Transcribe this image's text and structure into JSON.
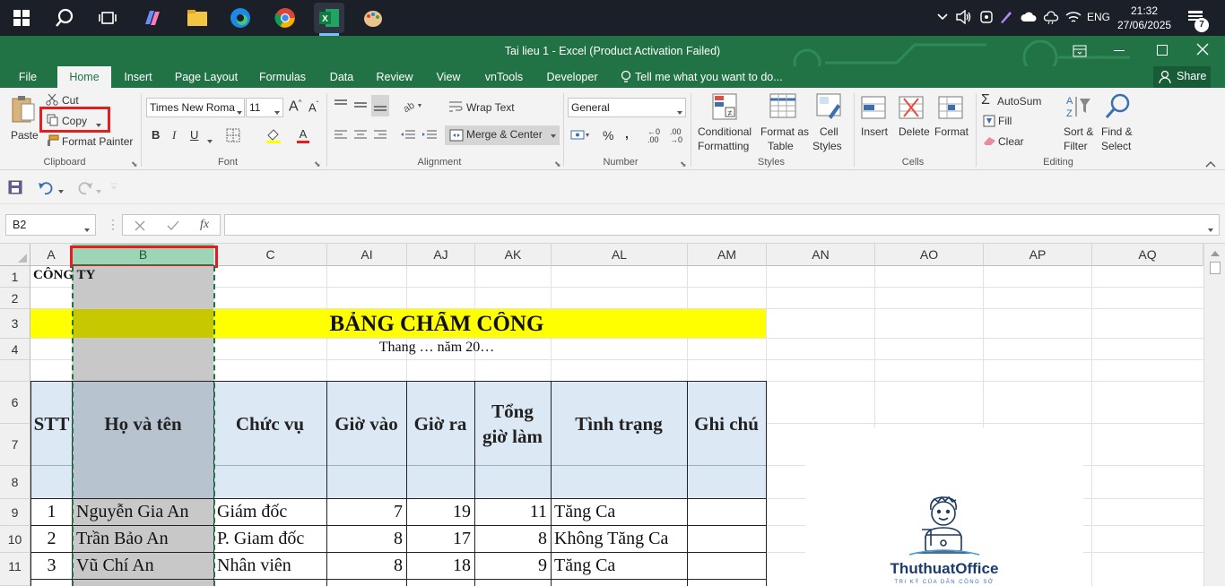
{
  "taskbar": {
    "time": "21:32",
    "date": "27/06/2025",
    "lang": "ENG",
    "notif_count": "7"
  },
  "titlebar": {
    "title": "Tai lieu 1 - Excel (Product Activation Failed)"
  },
  "tabs": [
    "File",
    "Home",
    "Insert",
    "Page Layout",
    "Formulas",
    "Data",
    "Review",
    "View",
    "vnTools",
    "Developer"
  ],
  "tell_me": "Tell me what you want to do...",
  "share": "Share",
  "clipboard": {
    "paste": "Paste",
    "cut": "Cut",
    "copy": "Copy",
    "format_painter": "Format Painter",
    "label": "Clipboard"
  },
  "font": {
    "name": "Times New Roma",
    "size": "11",
    "bold": "B",
    "italic": "I",
    "underline": "U",
    "label": "Font"
  },
  "alignment": {
    "wrap": "Wrap Text",
    "merge": "Merge & Center",
    "label": "Alignment"
  },
  "number": {
    "format": "General",
    "label": "Number"
  },
  "styles": {
    "conditional": [
      "Conditional",
      "Formatting"
    ],
    "format_table": [
      "Format as",
      "Table"
    ],
    "cell_styles": [
      "Cell",
      "Styles"
    ],
    "label": "Styles"
  },
  "cells": {
    "insert": "Insert",
    "delete": "Delete",
    "format": "Format",
    "label": "Cells"
  },
  "editing": {
    "autosum": "AutoSum",
    "fill": "Fill",
    "clear": "Clear",
    "sort": [
      "Sort &",
      "Filter"
    ],
    "find": [
      "Find &",
      "Select"
    ],
    "label": "Editing"
  },
  "namebox": "B2",
  "fx": "fx",
  "columns": [
    "A",
    "B",
    "C",
    "AI",
    "AJ",
    "AK",
    "AL",
    "AM",
    "AN",
    "AO",
    "AP",
    "AQ"
  ],
  "rows": [
    "1",
    "2",
    "3",
    "4",
    "6",
    "7",
    "8",
    "9",
    "10",
    "11"
  ],
  "sheet": {
    "company": "CÔNG TY",
    "title": "BẢNG CHẤM CÔNG",
    "subtitle": "Thang … năm 20…",
    "headers": {
      "stt": "STT",
      "name": "Họ và tên",
      "position": "Chức vụ",
      "in": "Giờ vào",
      "out": "Giờ ra",
      "total": [
        "Tổng",
        "giờ làm"
      ],
      "status": "Tình trạng",
      "note": "Ghi chú"
    },
    "data": [
      {
        "stt": "1",
        "name": "Nguyễn Gia An",
        "position": "Giám đốc",
        "in": "7",
        "out": "19",
        "total": "11",
        "status": "Tăng Ca"
      },
      {
        "stt": "2",
        "name": "Trần Bảo An",
        "position": "P. Giam đốc",
        "in": "8",
        "out": "17",
        "total": "8",
        "status": "Không Tăng Ca"
      },
      {
        "stt": "3",
        "name": "Vũ Chí An",
        "position": "Nhân viên",
        "in": "8",
        "out": "18",
        "total": "9",
        "status": "Tăng Ca"
      }
    ]
  },
  "watermark": {
    "brand": "ThuthuatOffice",
    "tagline": "TRI KỶ CỦA DÂN CÔNG SỞ"
  },
  "colors": {
    "excel_green": "#217346",
    "title_yellow": "#ffff00",
    "header_blue": "#dce9f5",
    "selected_col": "#c8c8c8",
    "highlight_red": "#e02020"
  }
}
